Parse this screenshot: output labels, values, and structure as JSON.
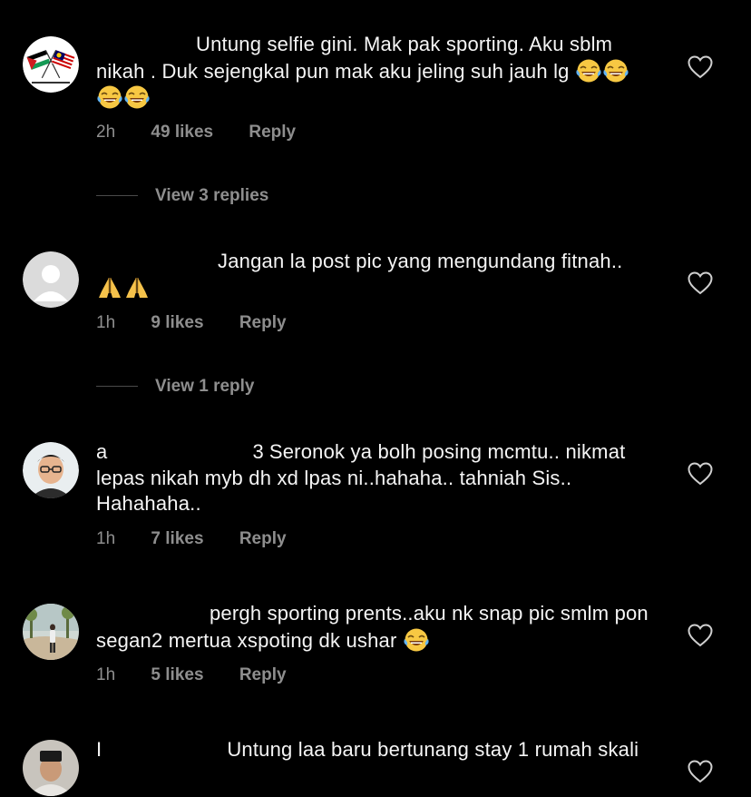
{
  "colors": {
    "background": "#000000",
    "text": "#f5f5f5",
    "secondary": "#8e8e8e"
  },
  "comments": [
    {
      "username_prefix": "",
      "text_parts": [
        "Untung selfie gini. Mak pak sporting. Aku sblm nikah . Duk sejengkal pun mak aku jeling suh jauh lg"
      ],
      "emojis": [
        "tears-of-joy-emoji",
        "tears-of-joy-emoji",
        "tears-of-joy-emoji",
        "tears-of-joy-emoji"
      ],
      "time": "2h",
      "likes": "49 likes",
      "reply": "Reply",
      "view_replies": "View 3 replies",
      "avatar": "flags-avatar"
    },
    {
      "username_prefix": "",
      "text": "Jangan la post pic yang mengundang fitnah..",
      "emojis": [
        "folded-hands-emoji",
        "folded-hands-emoji"
      ],
      "time": "1h",
      "likes": "9 likes",
      "reply": "Reply",
      "view_replies": "View 1 reply",
      "avatar": "default-avatar"
    },
    {
      "username_prefix": "a",
      "username_suffix": "3",
      "text": "Seronok ya bolh posing mcmtu.. nikmat lepas nikah myb dh xd lpas ni..hahaha.. tahniah Sis.. Hahahaha..",
      "time": "1h",
      "likes": "7 likes",
      "reply": "Reply",
      "avatar": "man-glasses-avatar"
    },
    {
      "username_prefix": "",
      "text": "pergh sporting prents..aku nk snap pic smlm pon segan2 mertua xspoting dk ushar",
      "emojis": [
        "tears-of-joy-emoji"
      ],
      "time": "1h",
      "likes": "5 likes",
      "reply": "Reply",
      "avatar": "outdoor-photo-avatar"
    },
    {
      "username_prefix": "I",
      "text": "Untung laa baru bertunang stay 1 rumah skali",
      "avatar": "songkok-avatar"
    }
  ]
}
